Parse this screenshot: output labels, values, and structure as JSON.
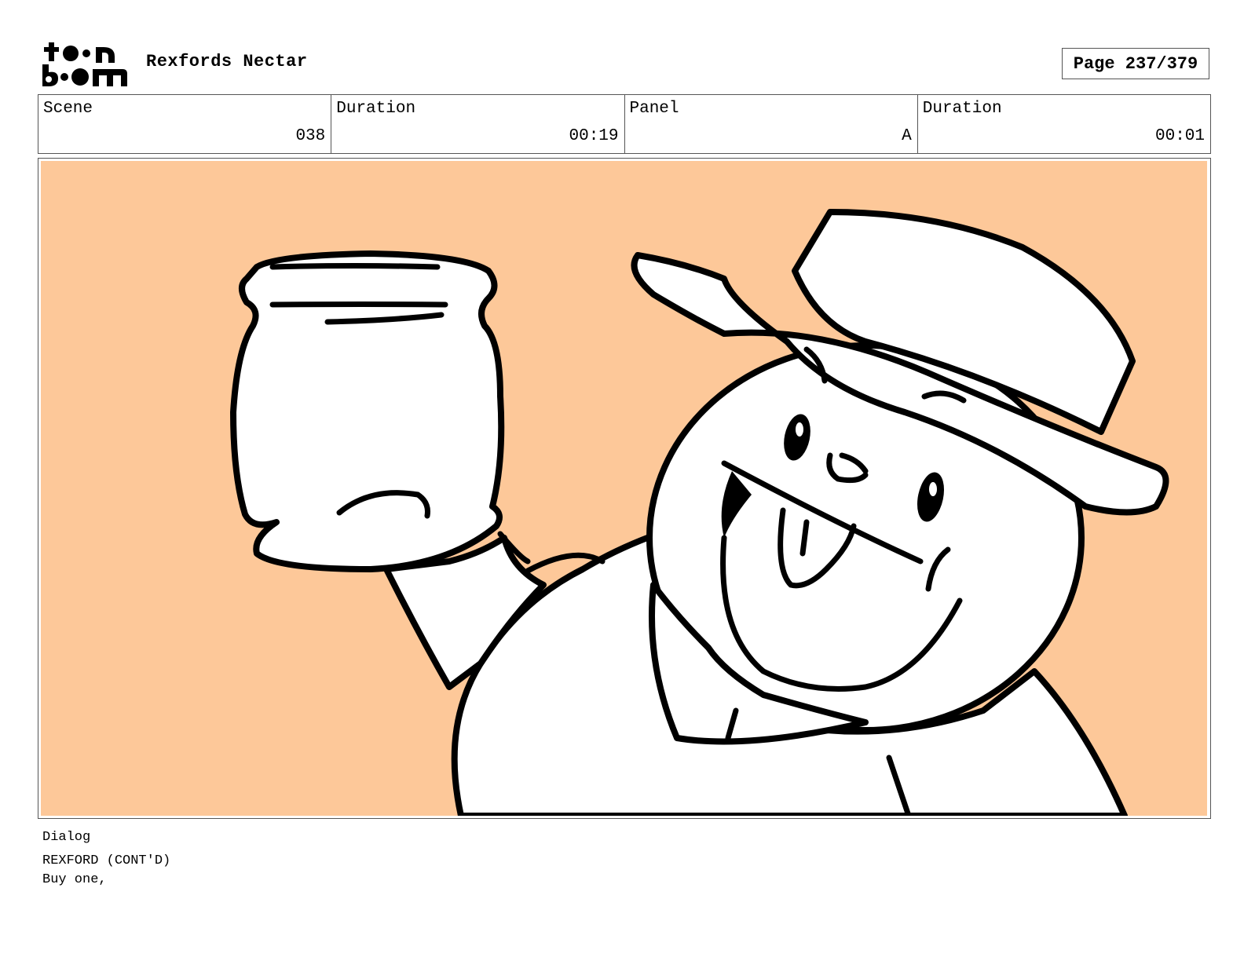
{
  "header": {
    "logo_name": "toon-boom-logo",
    "project_title": "Rexfords Nectar",
    "page_label": "Page 237/379"
  },
  "info": {
    "scene_label": "Scene",
    "scene_value": "038",
    "scene_duration_label": "Duration",
    "scene_duration_value": "00:19",
    "panel_label": "Panel",
    "panel_value": "A",
    "panel_duration_label": "Duration",
    "panel_duration_value": "00:01"
  },
  "panel": {
    "background_color": "#fdc899",
    "line_color": "#000000"
  },
  "dialog": {
    "label": "Dialog",
    "speaker": "REXFORD (CONT'D)",
    "line": "Buy one,"
  }
}
